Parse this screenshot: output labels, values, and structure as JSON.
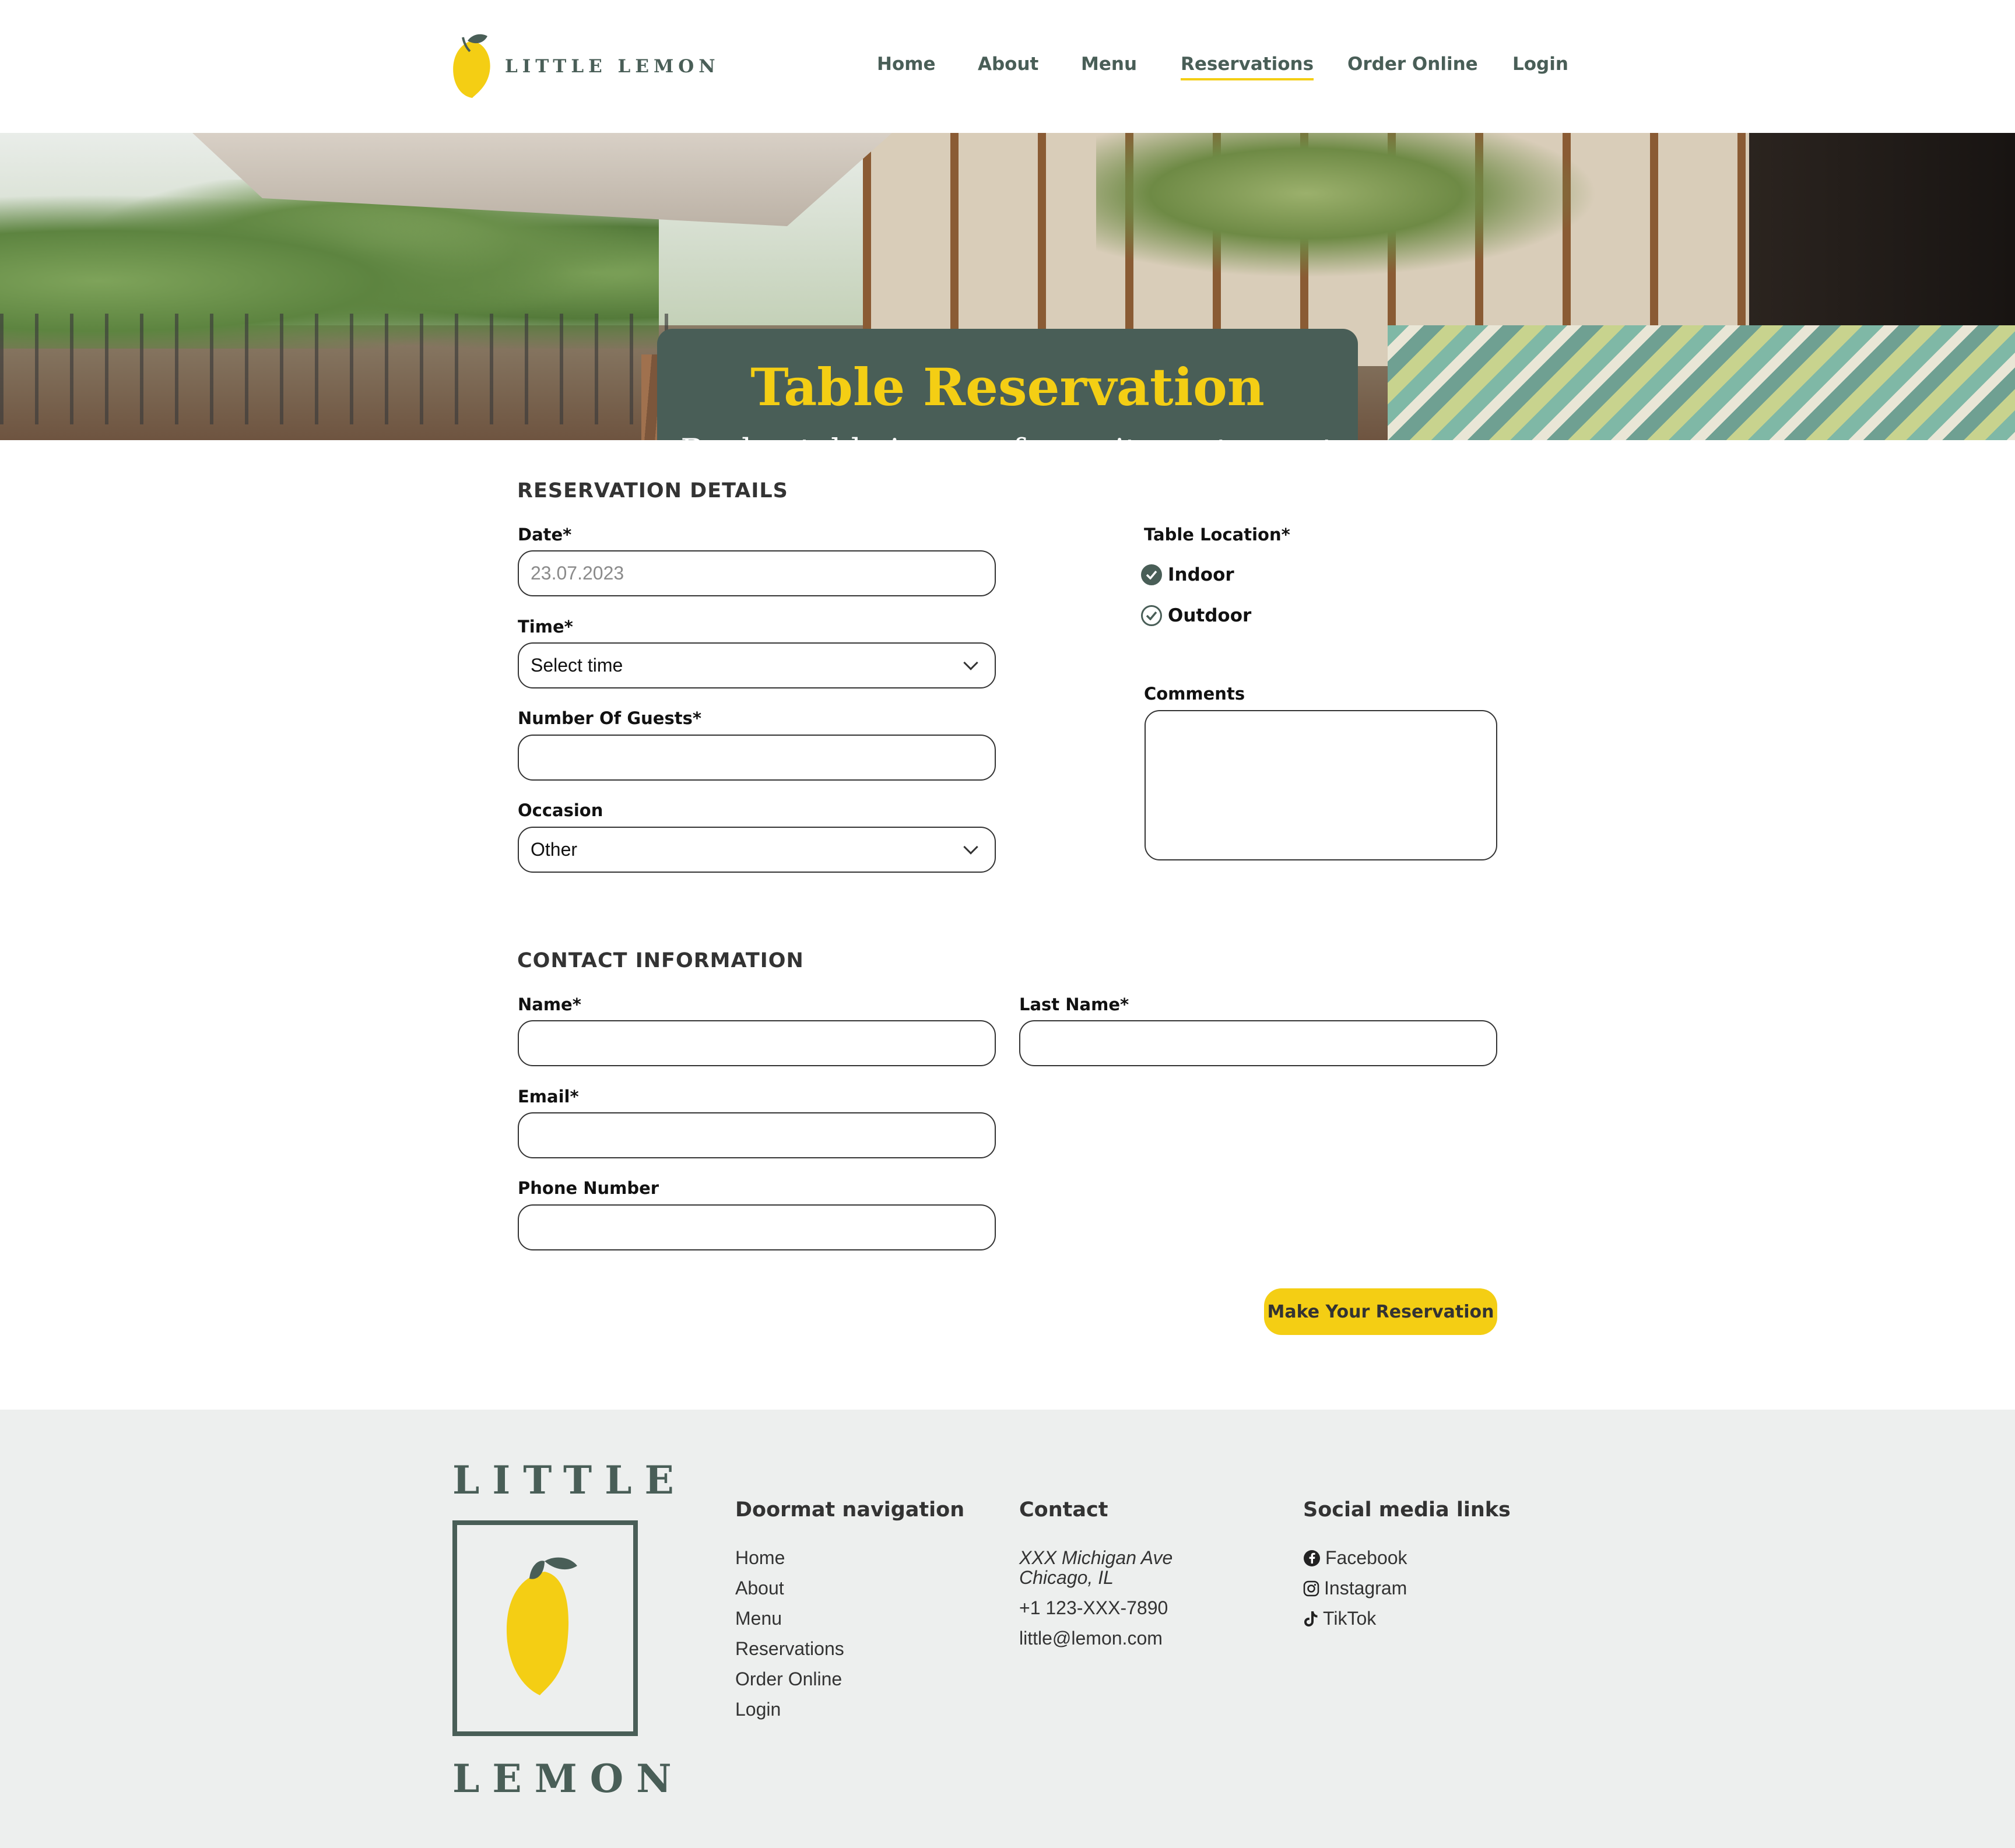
{
  "brand": {
    "name": "LITTLE LEMON",
    "logo_top": "LITTLE",
    "logo_bottom": "LEMON"
  },
  "nav": {
    "items": [
      "Home",
      "About",
      "Menu",
      "Reservations",
      "Order Online",
      "Login"
    ],
    "active": "Reservations"
  },
  "hero": {
    "title": "Table Reservation",
    "subtitle": "Book a table in your favourite restaurant"
  },
  "reservation": {
    "heading": "RESERVATION DETAILS",
    "date_label": "Date*",
    "date_value": "23.07.2023",
    "time_label": "Time*",
    "time_value": "Select time",
    "guests_label": "Number Of Guests*",
    "occasion_label": "Occasion",
    "occasion_value": "Other",
    "location_label": "Table Location*",
    "location_options": [
      "Indoor",
      "Outdoor"
    ],
    "location_selected": "Indoor",
    "comments_label": "Comments"
  },
  "contact": {
    "heading": "CONTACT INFORMATION",
    "name_label": "Name*",
    "last_name_label": "Last Name*",
    "email_label": "Email*",
    "phone_label": "Phone Number"
  },
  "submit_label": "Make Your Reservation",
  "footer": {
    "doormat_title": "Doormat navigation",
    "doormat_items": [
      "Home",
      "About",
      "Menu",
      "Reservations",
      "Order Online",
      "Login"
    ],
    "contact_title": "Contact",
    "address_line1": "XXX Michigan Ave",
    "address_line2": "Chicago, IL",
    "phone": "+1 123-XXX-7890",
    "email": "little@lemon.com",
    "social_title": "Social media links",
    "social_items": [
      "Facebook",
      "Instagram",
      "TikTok"
    ]
  },
  "colors": {
    "primary_green": "#495E57",
    "primary_yellow": "#F4CE14",
    "footer_bg": "#EDEFEE"
  },
  "icons": [
    "lemon-logo-icon",
    "chevron-down-icon",
    "check-circle-icon",
    "facebook-icon",
    "instagram-icon",
    "tiktok-icon"
  ]
}
